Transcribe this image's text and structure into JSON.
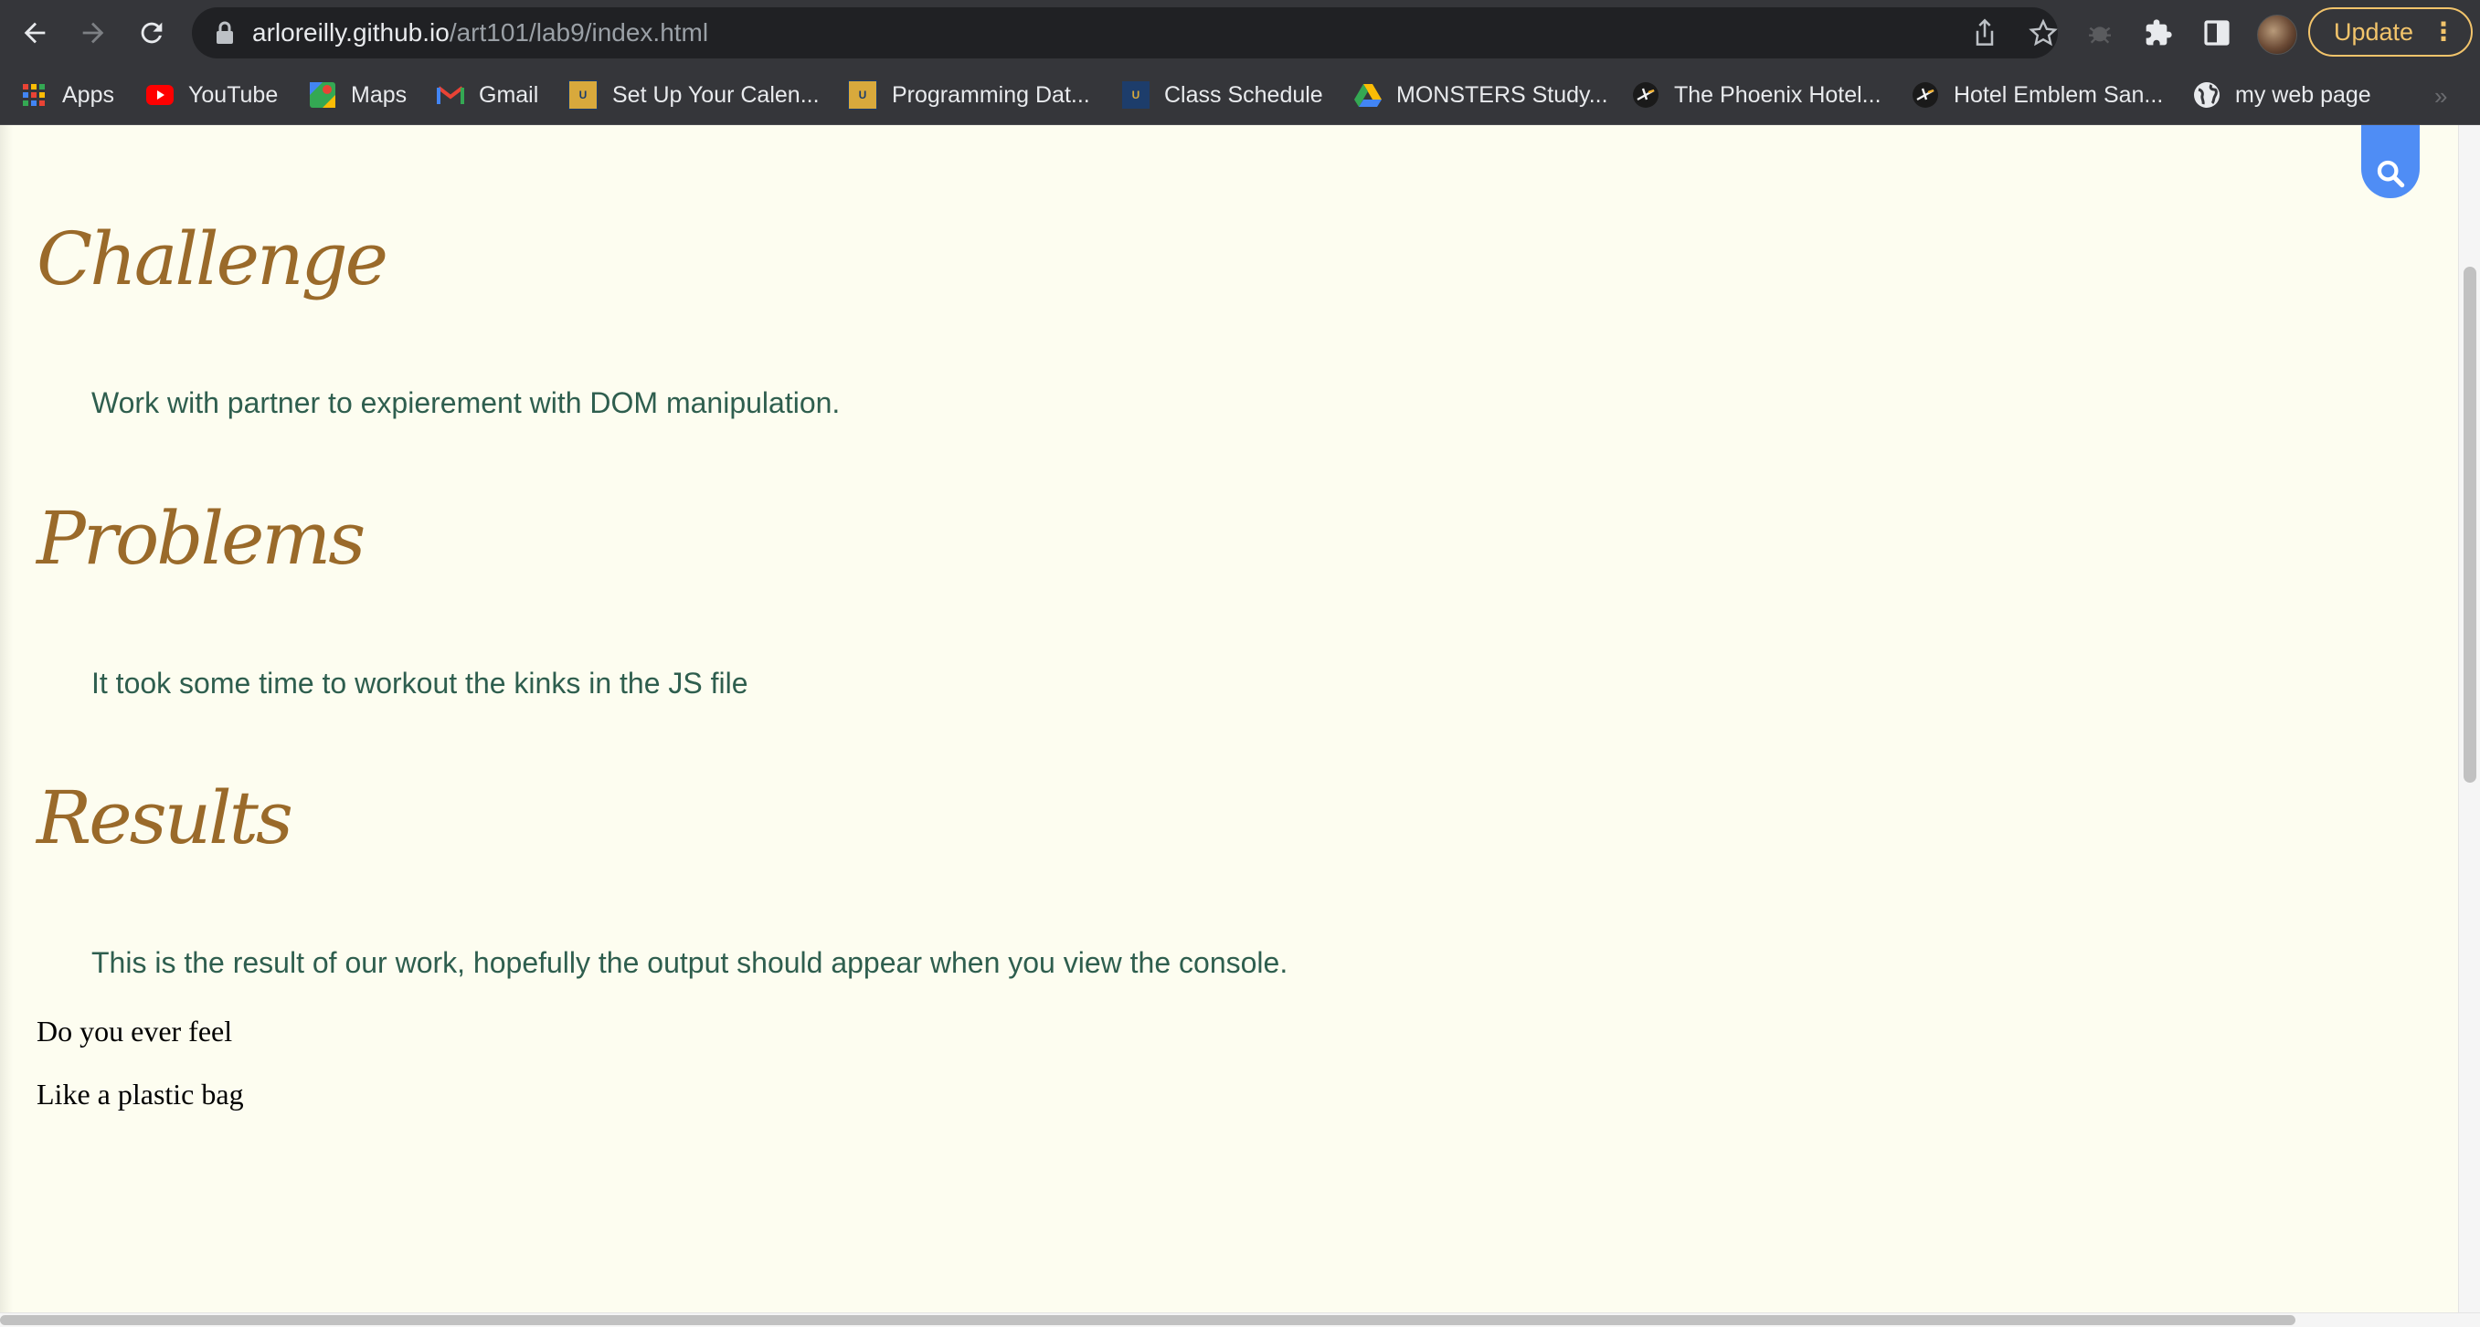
{
  "browser": {
    "url_host": "arloreilly.github.io",
    "url_path": "/art101/lab9/index.html",
    "update_label": "Update",
    "icons": {
      "back": "back-arrow-icon",
      "forward": "forward-arrow-icon",
      "reload": "reload-icon",
      "lock": "lock-icon",
      "share": "share-icon",
      "bookmark": "star-icon",
      "extensions": "puzzle-icon",
      "side_panel": "side-panel-icon",
      "menu": "kebab-menu-icon"
    }
  },
  "bookmarks": [
    {
      "label": "Apps",
      "icon": "apps-grid-icon"
    },
    {
      "label": "YouTube",
      "icon": "youtube-icon"
    },
    {
      "label": "Maps",
      "icon": "maps-icon"
    },
    {
      "label": "Gmail",
      "icon": "gmail-icon"
    },
    {
      "label": "Set Up Your Calen...",
      "icon": "ucsc-icon"
    },
    {
      "label": "Programming Dat...",
      "icon": "ucsc-icon"
    },
    {
      "label": "Class Schedule",
      "icon": "ucsc-icon"
    },
    {
      "label": "MONSTERS Study...",
      "icon": "drive-icon"
    },
    {
      "label": "The Phoenix Hotel...",
      "icon": "hotel-icon"
    },
    {
      "label": "Hotel Emblem San...",
      "icon": "hotel-icon"
    },
    {
      "label": "my web page",
      "icon": "globe-icon"
    }
  ],
  "page": {
    "sections": [
      {
        "heading": "Challenge",
        "text": "Work with partner to expierement with DOM manipulation."
      },
      {
        "heading": "Problems",
        "text": "It took some time to workout the kinks in the JS file"
      },
      {
        "heading": "Results",
        "text": "This is the result of our work, hopefully the output should appear when you view the console."
      }
    ],
    "output_lines": [
      "Do you ever feel",
      "Like a plastic bag"
    ]
  },
  "colors": {
    "page_bg": "#fdfdf0",
    "heading": "#9a6a2a",
    "body_text": "#2e5e4e",
    "search_button": "#4f8df5",
    "update_accent": "#f2c46b"
  }
}
